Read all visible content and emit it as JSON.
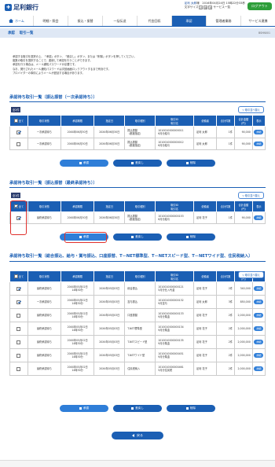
{
  "header": {
    "logo": "足利銀行",
    "user_name": "足利 太郎",
    "user_suffix": "様",
    "last_login": "2016年04月24日 15時22分33秒",
    "font_size_label": "文字サイズ",
    "font_small": "小",
    "font_mid": "中",
    "font_large": "大",
    "service_list": "サービス一覧",
    "logout": "ログアウト"
  },
  "nav": {
    "home": "ホーム",
    "items": [
      "明細・照会",
      "振込・振替",
      "一括伝送",
      "代金回収",
      "承認",
      "管理者業務",
      "サービス連携"
    ]
  },
  "page": {
    "breadcrumb_a": "承認",
    "breadcrumb_b": "取引一覧",
    "screen_id": "BSHN001"
  },
  "intro": [
    "承認する取引を選択の上、「承認」ボタン、「差戻し」ボタン、または「削除」ボタンを押してください。",
    "複数の取引を選択することで、連続して承認を行うことができます。",
    "承認を行う場合は、メール通知パスワードが必要です。",
    "なお、発行されたメール通知パスワードは次回画面ロックアウトするまで有効です。",
    "ブロバイダーの事情によりメールが遅延する場合があります。"
  ],
  "sort_label": "▽ 取引並べ替え",
  "section1": {
    "title": "承認待ち取引一覧（振込振替（一次承認待ち））",
    "count": "全2件",
    "headers": [
      "全て",
      "取引状態",
      "承認期限",
      "指定日",
      "取引種別",
      "取引ID\n取引名",
      "依頼者",
      "合計件数",
      "合計金額\n(円)",
      "表示"
    ],
    "rows": [
      {
        "checked": true,
        "status": "一次承認待ち",
        "deadline": "20XX年06月30日",
        "date": "20XX年06月30日",
        "type": "振込振替\n（都度指定）",
        "id": "1010010000000011\n6月分給与",
        "requester": "足利 太郎",
        "count": "1件",
        "amount": "90,000",
        "show": "詳細"
      },
      {
        "checked": false,
        "status": "一次承認待ち",
        "deadline": "20XX年06月30日",
        "date": "20XX年06月30日",
        "type": "振込振替\n（都度指定）",
        "id": "1010010000000012\n6月分給与",
        "requester": "足利 太郎",
        "count": "1件",
        "amount": "90,000",
        "show": "詳細"
      }
    ]
  },
  "section2": {
    "title": "承認待ち取引一覧（振込振替（最終承認待ち））",
    "count": "全1件",
    "headers": [
      "全て",
      "取引状態",
      "承認期限",
      "指定日",
      "取引種別",
      "取引ID\n取引名",
      "依頼者",
      "合計件数",
      "合計金額\n(円)",
      "表示"
    ],
    "rows": [
      {
        "checked": true,
        "status": "最終承認待ち",
        "deadline": "20XX年06月30日",
        "date": "20XX年06月30日",
        "type": "振込振替\n（都度指定）",
        "id": "1010010000000153\n6月分給与",
        "requester": "足利 花子",
        "count": "1件",
        "amount": "90,000",
        "show": "詳細"
      }
    ]
  },
  "section3": {
    "title": "承認待ち取引一覧（総合振込、給与・賞与振込、口座振替、T－NET標準型、T－NETスピード型、T－NETワイド型、住民税納入）",
    "headers": [
      "全て",
      "取引状態",
      "承認期限",
      "指定日",
      "取引種別",
      "取引ID\n取引名",
      "依頼者",
      "合計件数",
      "合計金額\n(円)",
      "表示"
    ],
    "rows": [
      {
        "checked": true,
        "status": "最終承認待ち",
        "deadline": "20XX年05月02日\n14時30分",
        "date": "20XX年05月03日",
        "type": "総合振込",
        "id": "1010010000000121\n5月分仕入代金",
        "requester": "足利 花子",
        "count": "2件",
        "amount": "340,000",
        "show": "詳細"
      },
      {
        "checked": true,
        "status": "一次承認待ち",
        "deadline": "20XX年05月02日\n14時30分",
        "date": "20XX年05月03日",
        "type": "賞与振込",
        "id": "1010010000000132\n9月賞与",
        "requester": "足利 太郎",
        "count": "3件",
        "amount": "850,000",
        "show": "詳細"
      },
      {
        "checked": false,
        "status": "最終承認待ち",
        "deadline": "20XX年05月02日\n14時30分",
        "date": "20XX年05月03日",
        "type": "口座振替",
        "id": "1010010000000133\n9月分集金",
        "requester": "足利 花子",
        "count": "2件",
        "amount": "2,000,000",
        "show": "詳細"
      },
      {
        "checked": false,
        "status": "最終承認待ち",
        "deadline": "20XX年05月02日\n14時30分",
        "date": "20XX年05月03日",
        "type": "T-NET標準型",
        "id": "1010010000000134\n9月分集金",
        "requester": "足利 花子",
        "count": "2件",
        "amount": "2,000,000",
        "show": "詳細"
      },
      {
        "checked": false,
        "status": "最終承認待ち",
        "deadline": "20XX年05月02日\n14時30分",
        "date": "20XX年05月03日",
        "type": "T-NETスピード型",
        "id": "1010010000000135\n9月分集金",
        "requester": "足利 花子",
        "count": "2件",
        "amount": "2,000,000",
        "show": "詳細"
      },
      {
        "checked": false,
        "status": "最終承認待ち",
        "deadline": "20XX年05月02日\n14時30分",
        "date": "20XX年05月03日",
        "type": "T-NETワイド型",
        "id": "1010010000000451\n9月分集金",
        "requester": "足利 花子",
        "count": "2件",
        "amount": "2,000,000",
        "show": "詳細"
      },
      {
        "checked": false,
        "status": "最終承認待ち",
        "deadline": "20XX年05月02日\n14時30分",
        "date": "20XX年05月03日",
        "type": "住民税納入",
        "id": "1010010000000461\n5月分住民税",
        "requester": "足利 花子",
        "count": "2件",
        "amount": "2,000,000",
        "show": "詳細"
      }
    ]
  },
  "buttons": {
    "approve": "承認",
    "reject": "差戻し",
    "delete": "削除",
    "back": "戻る"
  },
  "colors": {
    "primary": "#1b5fb4",
    "button": "#2f7ed8",
    "logout": "#2e9e3a",
    "highlight": "#e0302c"
  }
}
